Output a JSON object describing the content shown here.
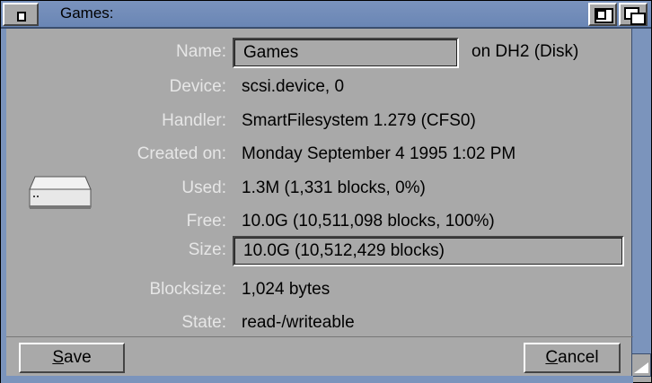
{
  "window": {
    "title": "Games:"
  },
  "icons": {
    "close": "close-gadget-icon",
    "zoom": "zoom-gadget-icon",
    "depth": "depth-gadget-icon",
    "drive": "hard-drive-icon",
    "resize": "resize-gadget-icon"
  },
  "info": {
    "name": {
      "label": "Name:",
      "value": "Games",
      "suffix": "on DH2 (Disk)"
    },
    "device": {
      "label": "Device:",
      "value": "scsi.device, 0"
    },
    "handler": {
      "label": "Handler:",
      "value": "SmartFilesystem 1.279  (CFS0)"
    },
    "created": {
      "label": "Created on:",
      "value": "Monday September  4 1995 1:02 PM"
    },
    "used": {
      "label": "Used:",
      "value": "1.3M (1,331 blocks, 0%)"
    },
    "free": {
      "label": "Free:",
      "value": "10.0G (10,511,098 blocks, 100%)"
    },
    "size": {
      "label": "Size:",
      "value": "10.0G (10,512,429 blocks)"
    },
    "blocksize": {
      "label": "Blocksize:",
      "value": "1,024 bytes"
    },
    "state": {
      "label": "State:",
      "value": "read-/writeable"
    }
  },
  "buttons": {
    "save_rest": "ave",
    "save_key": "S",
    "cancel_key": "C",
    "cancel_rest": "ancel"
  }
}
